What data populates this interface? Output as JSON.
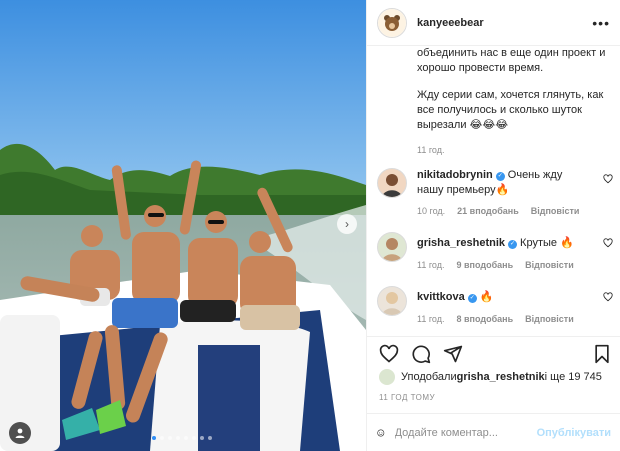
{
  "post": {
    "author": "kanyeeebear",
    "caption_lines": [
      "объединить нас в еще один проект и хорошо провести время.",
      "Жду серии сам, хочется глянуть, как все получилось и сколько шуток вырезали 😂😂😂"
    ],
    "caption_time": "11 год.",
    "comments": [
      {
        "user": "nikitadobrynin",
        "verified": true,
        "text": "Очень жду нашу премьеру🔥",
        "time": "10 год.",
        "likes": "21 вподобань",
        "reply": "Відповісти"
      },
      {
        "user": "grisha_reshetnik",
        "verified": true,
        "text": "Крутые 🔥",
        "time": "11 год.",
        "likes": "9 вподобань",
        "reply": "Відповісти"
      },
      {
        "user": "kvittkova",
        "verified": true,
        "text": "🔥",
        "time": "11 год.",
        "likes": "8 вподобань",
        "reply": "Відповісти"
      }
    ],
    "liked_by_prefix": "Уподобали ",
    "liked_by_user": "grisha_reshetnik",
    "liked_by_suffix": " і ще 19 745",
    "post_time": "11 ГОД ТОМУ",
    "comment_placeholder": "Додайте коментар...",
    "publish_label": "Опублікувати",
    "carousel": {
      "total": 8,
      "active": 0
    }
  },
  "colors": {
    "accent": "#3897f0",
    "publish_disabled": "#b2dffc",
    "muted": "#8e8e8e"
  },
  "icons": [
    "more-icon",
    "heart-icon",
    "comment-icon",
    "share-icon",
    "bookmark-icon",
    "emoji-icon",
    "user-tag-icon",
    "chevron-right-icon"
  ]
}
